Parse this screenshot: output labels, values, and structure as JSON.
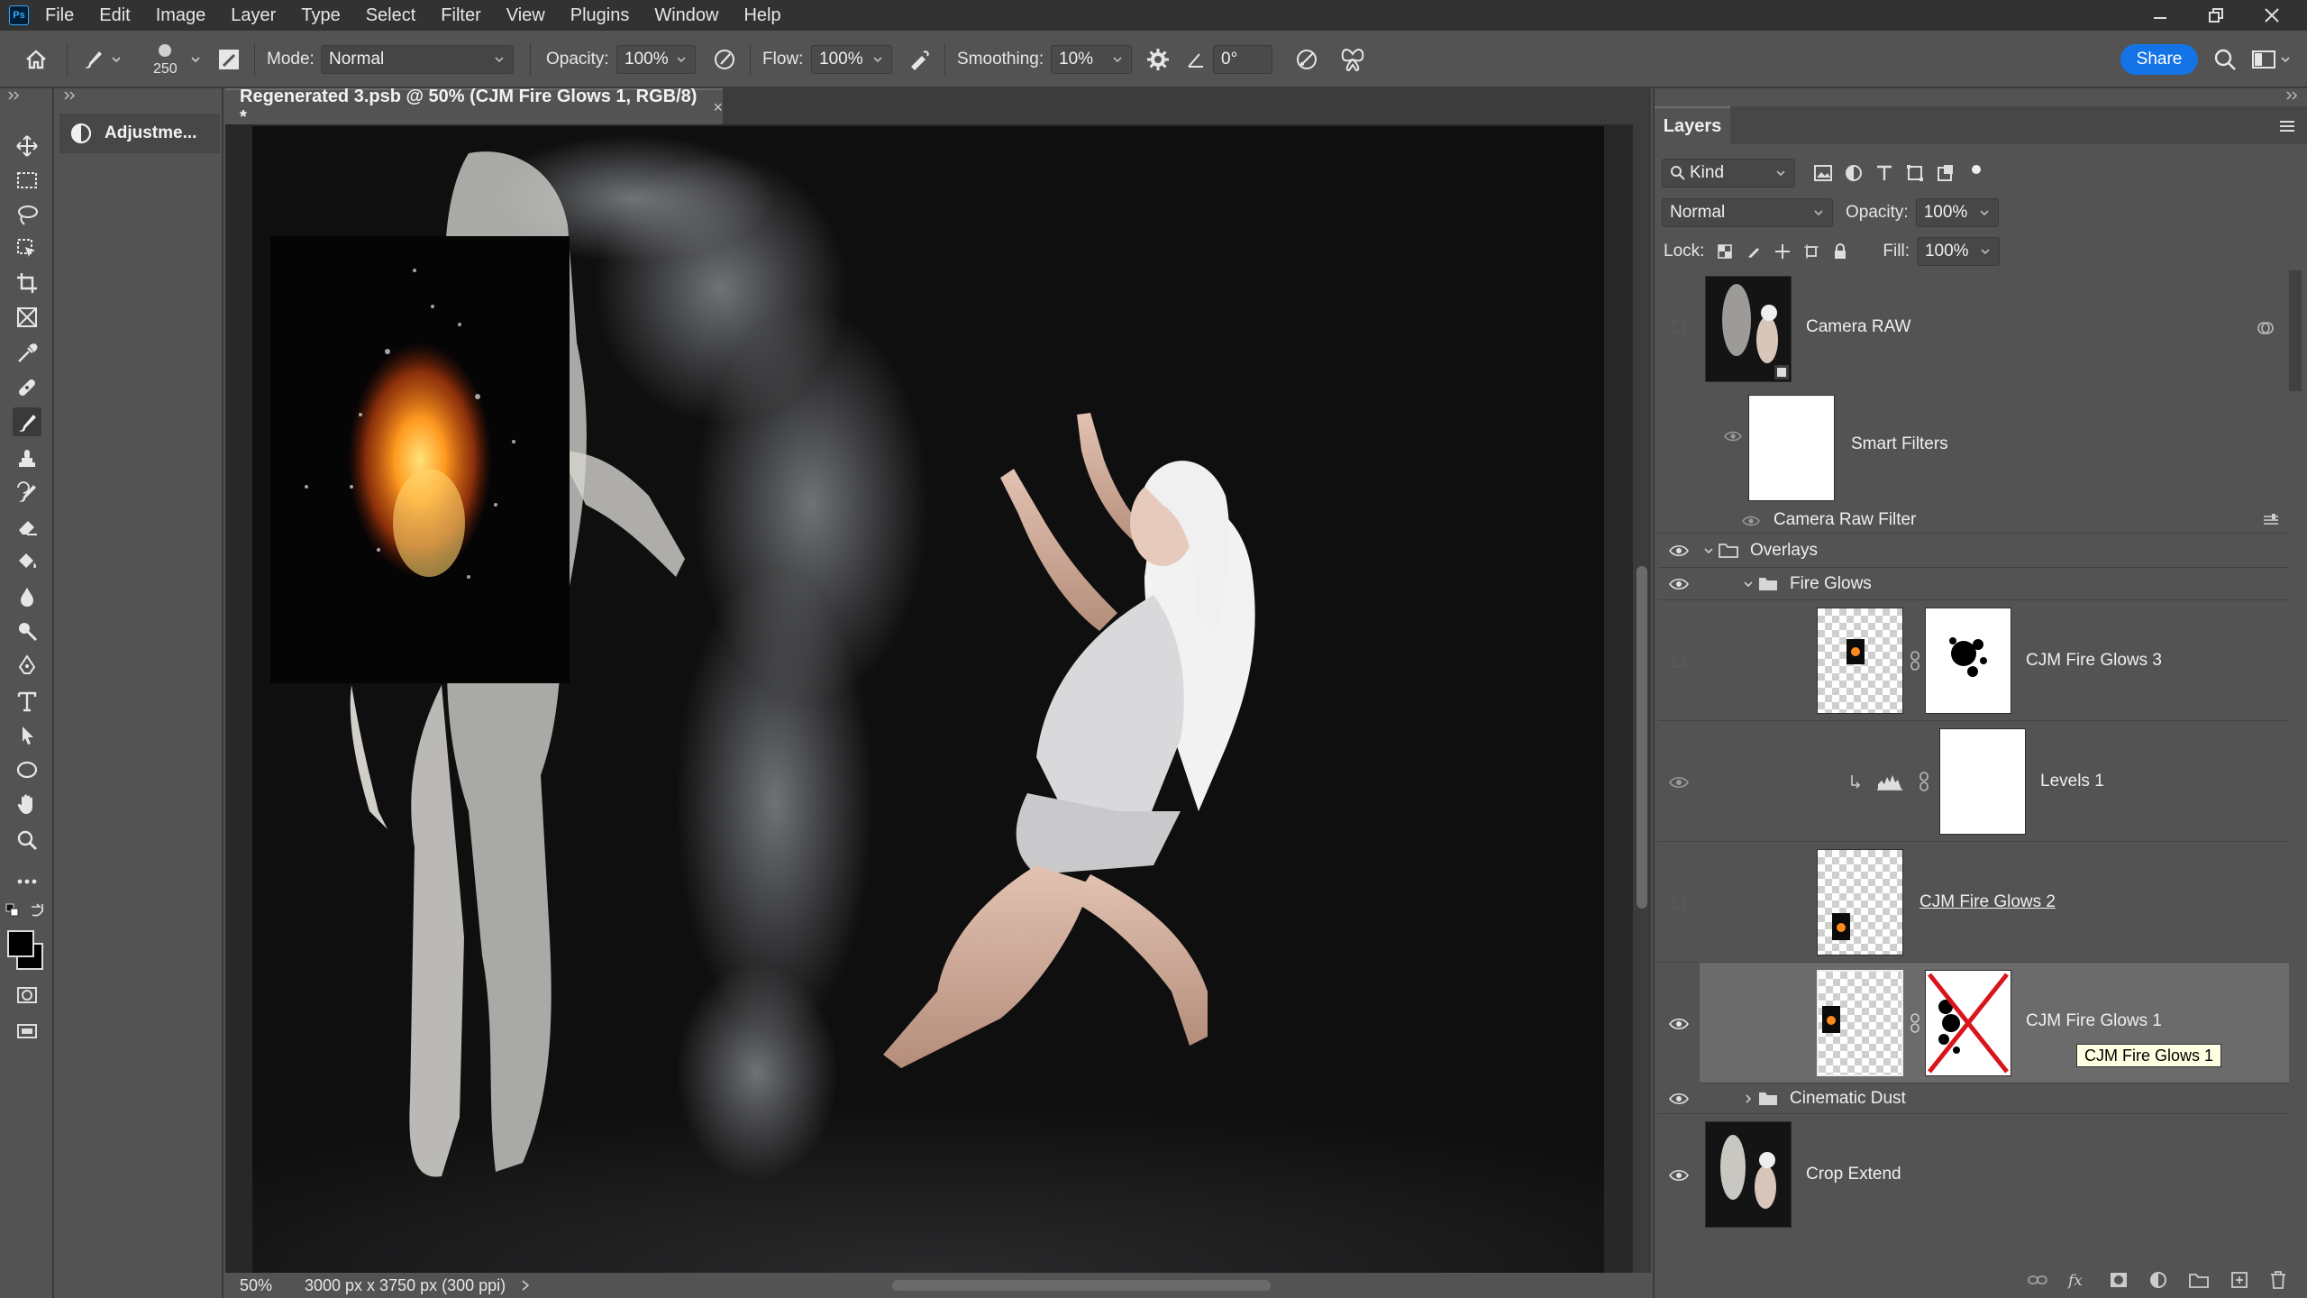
{
  "menu": {
    "items": [
      "File",
      "Edit",
      "Image",
      "Layer",
      "Type",
      "Select",
      "Filter",
      "View",
      "Plugins",
      "Window",
      "Help"
    ]
  },
  "options": {
    "brush_size": "250",
    "mode_label": "Mode:",
    "mode_value": "Normal",
    "opacity_label": "Opacity:",
    "opacity_value": "100%",
    "flow_label": "Flow:",
    "flow_value": "100%",
    "smoothing_label": "Smoothing:",
    "smoothing_value": "10%",
    "angle_value": "0°",
    "share_label": "Share"
  },
  "adjustments": {
    "tab_label": "Adjustme..."
  },
  "document": {
    "tab_title": "Regenerated 3.psb @ 50% (CJM Fire Glows 1, RGB/8) *",
    "close_glyph": "×",
    "zoom": "50%",
    "doc_info": "3000 px x 3750 px (300 ppi)"
  },
  "layers": {
    "tab_label": "Layers",
    "filter_kind": "Kind",
    "blend_mode": "Normal",
    "opacity_label": "Opacity:",
    "opacity_value": "100%",
    "lock_label": "Lock:",
    "fill_label": "Fill:",
    "fill_value": "100%",
    "tooltip": "CJM Fire Glows 1",
    "items": [
      {
        "name": "Camera RAW"
      },
      {
        "name": "Smart Filters"
      },
      {
        "name": "Camera Raw Filter"
      },
      {
        "name": "Overlays"
      },
      {
        "name": "Fire Glows"
      },
      {
        "name": "CJM Fire Glows 3"
      },
      {
        "name": "Levels 1"
      },
      {
        "name": "CJM Fire Glows 2"
      },
      {
        "name": "CJM Fire Glows 1"
      },
      {
        "name": "Cinematic Dust"
      },
      {
        "name": "Crop Extend"
      }
    ]
  },
  "colors": {
    "accent": "#1473e6",
    "panel_bg": "#535353",
    "menu_bg": "#323232",
    "canvas_bg": "#282828",
    "selected_layer": "#6b6b6b",
    "mask_cross": "#d9141b"
  }
}
